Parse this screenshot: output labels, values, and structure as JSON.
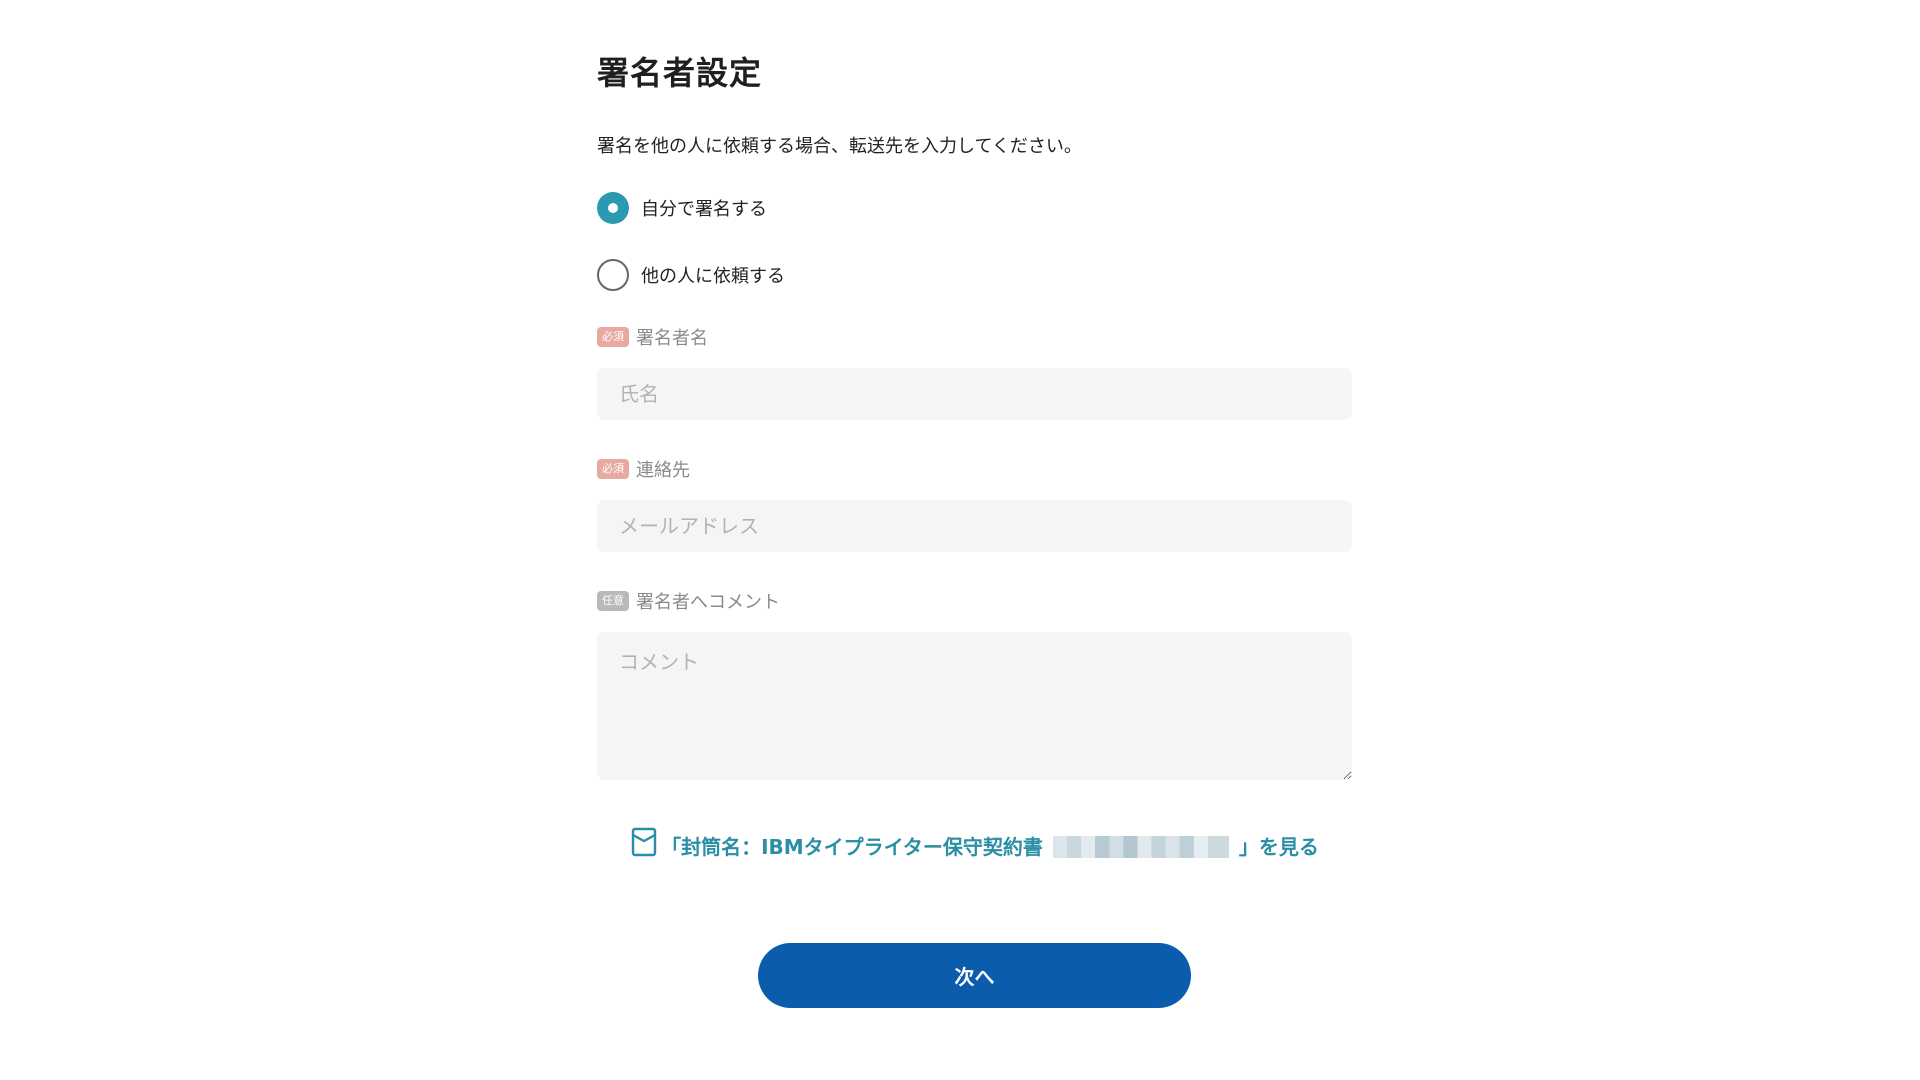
{
  "page": {
    "title": "署名者設定",
    "description": "署名を他の人に依頼する場合、転送先を入力してください。"
  },
  "options": [
    {
      "label": "自分で署名する",
      "checked": true
    },
    {
      "label": "他の人に依頼する",
      "checked": false
    }
  ],
  "fields": {
    "signer_name": {
      "badge": "必須",
      "label": "署名者名",
      "placeholder": "氏名",
      "value": ""
    },
    "contact": {
      "badge": "必須",
      "label": "連絡先",
      "placeholder": "メールアドレス",
      "value": ""
    },
    "comment": {
      "badge": "任意",
      "label": "署名者へコメント",
      "placeholder": "コメント",
      "value": ""
    }
  },
  "envelope_link": {
    "prefix": "「封筒名：IBMタイプライター保守契約書",
    "suffix": "」を見る",
    "icon": "document-icon"
  },
  "next_button": {
    "label": "次へ"
  },
  "colors": {
    "accent_teal": "#2a9ab0",
    "link_teal": "#2a8fa6",
    "primary_button": "#0b5cad",
    "required_badge": "#e8a9a0",
    "optional_badge": "#b9b9b9",
    "input_bg": "#f5f5f6"
  }
}
